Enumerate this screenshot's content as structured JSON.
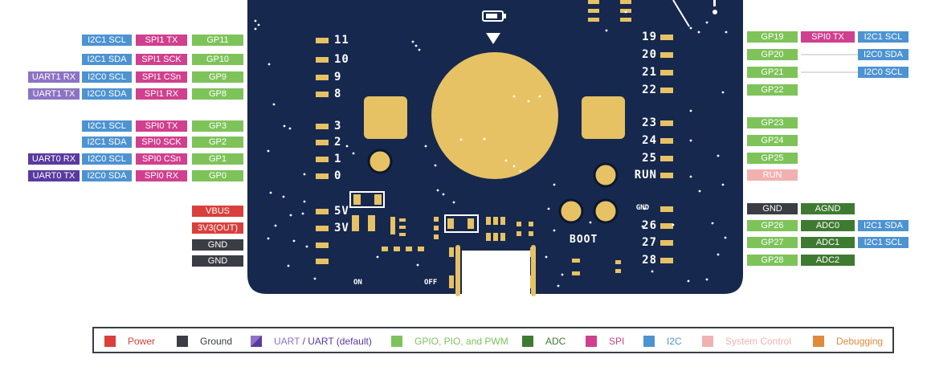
{
  "left_pins": [
    {
      "labels": [
        {
          "text": "I2C1 SCL",
          "cls": "i2c"
        },
        {
          "text": "SPI1 TX",
          "cls": "spi"
        },
        {
          "text": "GP11",
          "cls": "gpio"
        }
      ],
      "silk": "11"
    },
    {
      "labels": [
        {
          "text": "I2C1 SDA",
          "cls": "i2c"
        },
        {
          "text": "SPI1 SCK",
          "cls": "spi"
        },
        {
          "text": "GP10",
          "cls": "gpio"
        }
      ],
      "silk": "10"
    },
    {
      "labels": [
        {
          "text": "UART1 RX",
          "cls": "uart"
        },
        {
          "text": "I2C0 SCL",
          "cls": "i2c"
        },
        {
          "text": "SPI1 CSn",
          "cls": "spi"
        },
        {
          "text": "GP9",
          "cls": "gpio"
        }
      ],
      "silk": "9"
    },
    {
      "labels": [
        {
          "text": "UART1 TX",
          "cls": "uart"
        },
        {
          "text": "I2C0 SDA",
          "cls": "i2c"
        },
        {
          "text": "SPI1 RX",
          "cls": "spi"
        },
        {
          "text": "GP8",
          "cls": "gpio"
        }
      ],
      "silk": "8"
    },
    {
      "labels": [
        {
          "text": "I2C1 SCL",
          "cls": "i2c"
        },
        {
          "text": "SPI0 TX",
          "cls": "spi"
        },
        {
          "text": "GP3",
          "cls": "gpio"
        }
      ],
      "silk": "3"
    },
    {
      "labels": [
        {
          "text": "I2C1 SDA",
          "cls": "i2c"
        },
        {
          "text": "SPI0 SCK",
          "cls": "spi"
        },
        {
          "text": "GP2",
          "cls": "gpio"
        }
      ],
      "silk": "2"
    },
    {
      "labels": [
        {
          "text": "UART0 RX",
          "cls": "uart0"
        },
        {
          "text": "I2C0 SCL",
          "cls": "i2c"
        },
        {
          "text": "SPI0 CSn",
          "cls": "spi"
        },
        {
          "text": "GP1",
          "cls": "gpio"
        }
      ],
      "silk": "1"
    },
    {
      "labels": [
        {
          "text": "UART0 TX",
          "cls": "uart0"
        },
        {
          "text": "I2C0 SDA",
          "cls": "i2c"
        },
        {
          "text": "SPI0 RX",
          "cls": "spi"
        },
        {
          "text": "GP0",
          "cls": "gpio"
        }
      ],
      "silk": "0"
    },
    {
      "labels": [
        {
          "text": "VBUS",
          "cls": "power"
        }
      ],
      "silk": "5V"
    },
    {
      "labels": [
        {
          "text": "3V3(OUT)",
          "cls": "power"
        }
      ],
      "silk": "3V"
    },
    {
      "labels": [
        {
          "text": "GND",
          "cls": "ground"
        }
      ],
      "silk": ""
    },
    {
      "labels": [
        {
          "text": "GND",
          "cls": "ground"
        }
      ],
      "silk": ""
    }
  ],
  "right_pins": [
    {
      "labels": [
        {
          "text": "GP19",
          "cls": "gpio"
        },
        {
          "text": "SPI0 TX",
          "cls": "spi"
        },
        {
          "text": "I2C1 SCL",
          "cls": "i2c"
        }
      ],
      "silk": "19"
    },
    {
      "labels": [
        {
          "text": "GP20",
          "cls": "gpio"
        },
        {
          "text": "I2C0 SDA",
          "cls": "i2c"
        }
      ],
      "silk": "20"
    },
    {
      "labels": [
        {
          "text": "GP21",
          "cls": "gpio"
        },
        {
          "text": "I2C0 SCL",
          "cls": "i2c"
        }
      ],
      "silk": "21"
    },
    {
      "labels": [
        {
          "text": "GP22",
          "cls": "gpio"
        }
      ],
      "silk": "22"
    },
    {
      "labels": [
        {
          "text": "GP23",
          "cls": "gpio"
        }
      ],
      "silk": "23"
    },
    {
      "labels": [
        {
          "text": "GP24",
          "cls": "gpio"
        }
      ],
      "silk": "24"
    },
    {
      "labels": [
        {
          "text": "GP25",
          "cls": "gpio"
        }
      ],
      "silk": "25"
    },
    {
      "labels": [
        {
          "text": "RUN",
          "cls": "sys"
        }
      ],
      "silk": "RUN"
    },
    {
      "labels": [
        {
          "text": "GND",
          "cls": "ground"
        },
        {
          "text": "AGND",
          "cls": "adc"
        }
      ],
      "silk": "GND"
    },
    {
      "labels": [
        {
          "text": "GP26",
          "cls": "gpio"
        },
        {
          "text": "ADC0",
          "cls": "adc"
        },
        {
          "text": "I2C1 SDA",
          "cls": "i2c"
        }
      ],
      "silk": "26"
    },
    {
      "labels": [
        {
          "text": "GP27",
          "cls": "gpio"
        },
        {
          "text": "ADC1",
          "cls": "adc"
        },
        {
          "text": "I2C1 SCL",
          "cls": "i2c"
        }
      ],
      "silk": "27"
    },
    {
      "labels": [
        {
          "text": "GP28",
          "cls": "gpio"
        },
        {
          "text": "ADC2",
          "cls": "adc"
        }
      ],
      "silk": "28"
    }
  ],
  "board": {
    "boot_label": "BOOT",
    "on_label": "ON",
    "off_label": "OFF"
  },
  "legend": [
    {
      "label": "Power",
      "color": "#d9403c",
      "text_color": "#d9403c"
    },
    {
      "label": "Ground",
      "color": "#3a3d44",
      "text_color": "#3a3d44"
    },
    {
      "label": "UART",
      "label2": "/ UART (default)",
      "color": "#8c74c4",
      "color2": "#5a3aa0",
      "text_color": "#8c74c4",
      "text_color2": "#5a3aa0"
    },
    {
      "label": "GPIO, PIO, and PWM",
      "color": "#7ec35a",
      "text_color": "#7ec35a"
    },
    {
      "label": "ADC",
      "color": "#3f7a32",
      "text_color": "#3f7a32"
    },
    {
      "label": "SPI",
      "color": "#d0408e",
      "text_color": "#d0408e"
    },
    {
      "label": "I2C",
      "color": "#4d93d1",
      "text_color": "#4d93d1"
    },
    {
      "label": "System Control",
      "color": "#f2b1b1",
      "text_color": "#f2b1b1"
    },
    {
      "label": "Debugging",
      "color": "#e08a3c",
      "text_color": "#e08a3c"
    }
  ],
  "colors": {
    "board": "#16284d",
    "gold": "#e6c265",
    "silk": "#ffffff"
  }
}
